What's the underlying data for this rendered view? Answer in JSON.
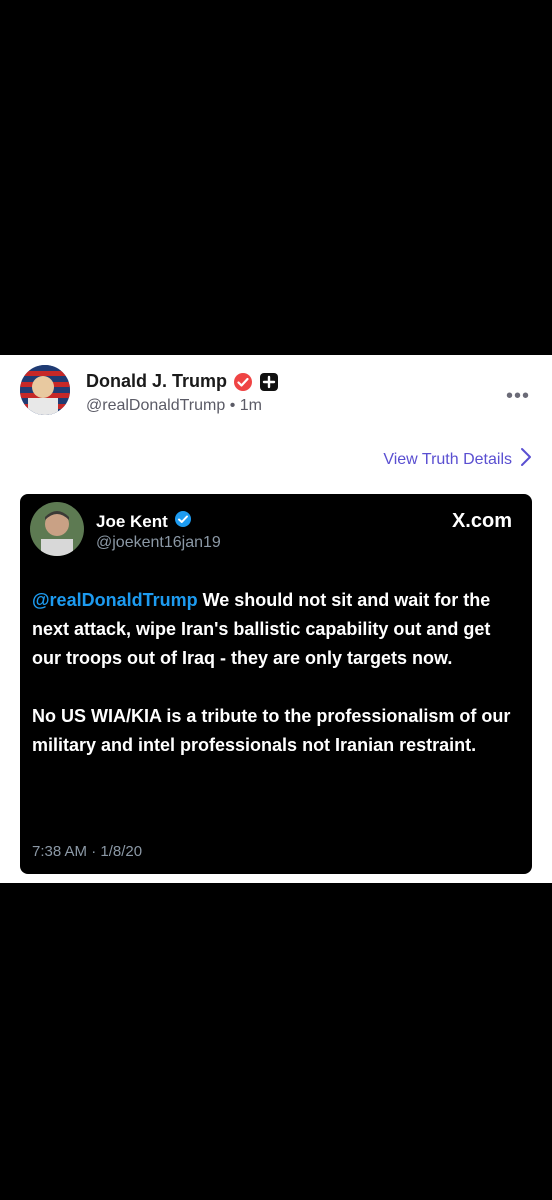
{
  "post": {
    "author_name": "Donald J. Trump",
    "author_handle": "@realDonaldTrump",
    "separator": "•",
    "time_ago": "1m",
    "more_label": "•••",
    "view_details_label": "View Truth Details",
    "colors": {
      "accent": "#5a4fd1",
      "verified": "#ef4444"
    }
  },
  "embedded_tweet": {
    "author_name": "Joe Kent",
    "author_handle": "@joekent16jan19",
    "source_label": "X.com",
    "mention": "@realDonaldTrump",
    "text_1": "We should not sit and wait for the next attack, wipe Iran's ballistic capability out and get our troops out of Iraq - they are only targets now.",
    "text_2": "No US WIA/KIA is a tribute to the professionalism of our military and intel professionals not Iranian restraint.",
    "timestamp": "7:38 AM · 1/8/20",
    "colors": {
      "mention": "#1d9bf0",
      "verified": "#1d9bf0"
    }
  }
}
